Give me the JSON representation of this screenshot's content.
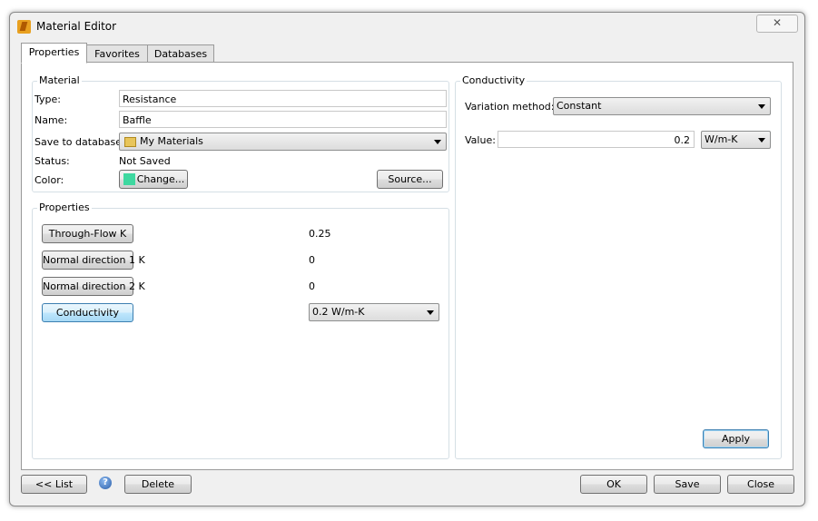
{
  "window": {
    "title": "Material Editor",
    "close_glyph": "✕"
  },
  "tabs": [
    {
      "label": "Properties",
      "active": true
    },
    {
      "label": "Favorites",
      "active": false
    },
    {
      "label": "Databases",
      "active": false
    }
  ],
  "material": {
    "group_title": "Material",
    "type_label": "Type:",
    "type_value": "Resistance",
    "name_label": "Name:",
    "name_value": "Baffle",
    "save_label": "Save to database:",
    "save_value": "My Materials",
    "status_label": "Status:",
    "status_value": "Not Saved",
    "color_label": "Color:",
    "color_button": "Change...",
    "color_swatch": "#3ed8a0",
    "source_button": "Source..."
  },
  "properties": {
    "group_title": "Properties",
    "rows": [
      {
        "button": "Through-Flow K",
        "value": "0.25"
      },
      {
        "button": "Normal direction 1 K",
        "value": "0"
      },
      {
        "button": "Normal direction 2 K",
        "value": "0"
      },
      {
        "button": "Conductivity",
        "value": "0.2 W/m-K",
        "selected": true
      }
    ]
  },
  "conductivity": {
    "group_title": "Conductivity",
    "variation_label": "Variation method:",
    "variation_value": "Constant",
    "value_label": "Value:",
    "value": "0.2",
    "unit": "W/m-K",
    "apply_button": "Apply"
  },
  "footer": {
    "list_button": "<< List",
    "help_glyph": "?",
    "delete_button": "Delete",
    "ok_button": "OK",
    "save_button": "Save",
    "close_button": "Close"
  },
  "colors": {
    "accent": "#3c7fb1",
    "selected_button": "#bee6fd"
  }
}
